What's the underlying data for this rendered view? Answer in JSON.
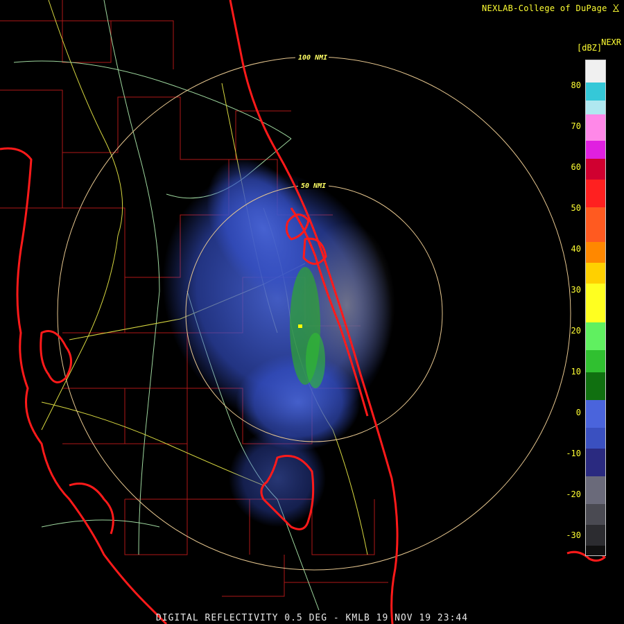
{
  "credit": "NEXLAB-College of DuPage",
  "product": "NEXR",
  "units": "[dBZ]",
  "footer": "DIGITAL REFLECTIVITY 0.5 DEG - KMLB 19 NOV 19 23:44",
  "rings": [
    "100 NMI",
    "50 NMI"
  ],
  "legend": {
    "ticks": [
      "80",
      "70",
      "60",
      "50",
      "40",
      "30",
      "20",
      "10",
      "0",
      "-10",
      "-20",
      "-30"
    ],
    "colors": {
      "cyan": "#35c8d8",
      "magenta": "#ff00ff",
      "red": "#ff1010",
      "orange": "#ff8800",
      "yellow": "#ffff00",
      "green": "#30d030",
      "blue": "#3a5acd",
      "gray": "#6a6a7a"
    }
  },
  "colors": {
    "coast": "#ff1a1a",
    "county": "#b01818",
    "road": "#d8d840",
    "hwy": "#9fd89f",
    "ring": "#e8c890"
  }
}
